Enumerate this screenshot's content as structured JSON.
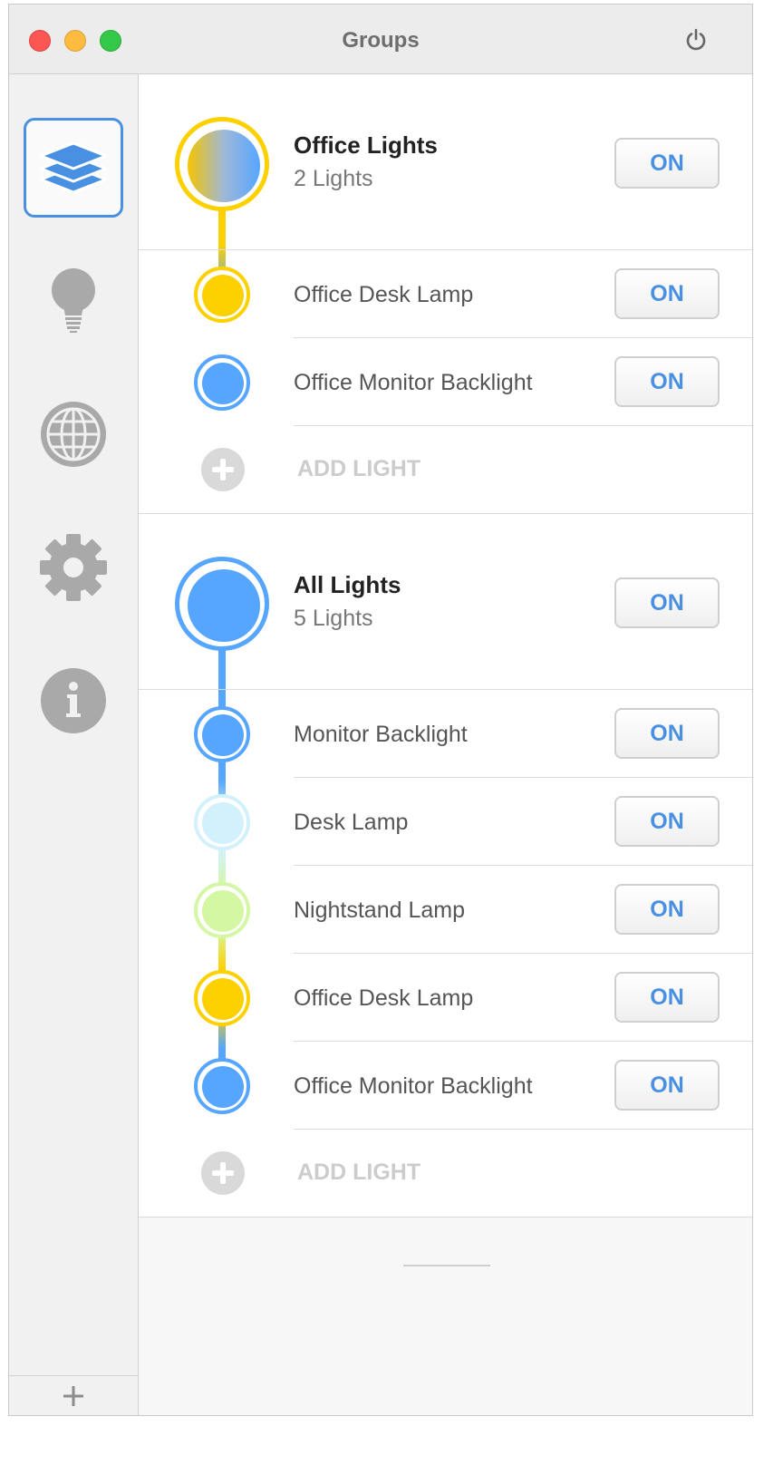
{
  "window": {
    "title": "Groups"
  },
  "sidebar": {
    "items": [
      {
        "icon": "layers-icon",
        "active": true
      },
      {
        "icon": "lightbulb-icon",
        "active": false
      },
      {
        "icon": "globe-icon",
        "active": false
      },
      {
        "icon": "gear-icon",
        "active": false
      },
      {
        "icon": "info-icon",
        "active": false
      }
    ],
    "footer_label": "+"
  },
  "groups": [
    {
      "name": "Office Lights",
      "count": "2 Lights",
      "button": "ON",
      "ring_color": "#fdd000",
      "fill": "linear-gradient(90deg,#f5c400,#9fb8d8,#56a6ff)",
      "lights": [
        {
          "name": "Office Desk Lamp",
          "button": "ON",
          "color": "#fdd000"
        },
        {
          "name": "Office Monitor Backlight",
          "button": "ON",
          "color": "#56a6ff"
        }
      ],
      "add_label": "ADD LIGHT"
    },
    {
      "name": "All Lights",
      "count": "5 Lights",
      "button": "ON",
      "ring_color": "#56a6ff",
      "fill": "#56a6ff",
      "lights": [
        {
          "name": "Monitor Backlight",
          "button": "ON",
          "color": "#56a6ff"
        },
        {
          "name": "Desk Lamp",
          "button": "ON",
          "color": "#d2f1fc"
        },
        {
          "name": "Nightstand Lamp",
          "button": "ON",
          "color": "#d4f7a4"
        },
        {
          "name": "Office Desk Lamp",
          "button": "ON",
          "color": "#fdd000"
        },
        {
          "name": "Office Monitor Backlight",
          "button": "ON",
          "color": "#56a6ff"
        }
      ],
      "add_label": "ADD LIGHT"
    }
  ]
}
